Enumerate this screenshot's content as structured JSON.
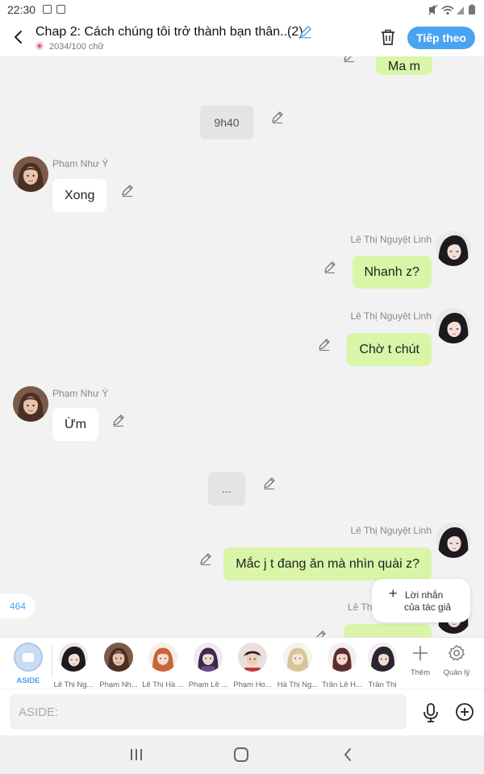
{
  "status_bar": {
    "time": "22:30"
  },
  "header": {
    "title": "Chap 2: Cách chúng tôi trở thành bạn thân..(2)",
    "word_count": "2034/100 chữ",
    "next_label": "Tiếp theo"
  },
  "messages": {
    "m0": {
      "text": "Ma m"
    },
    "m1": {
      "text": "9h40"
    },
    "m2": {
      "sender": "Phạm Như Ý",
      "text": "Xong"
    },
    "m3": {
      "sender": "Lê Thị Nguyệt Linh",
      "text": "Nhanh z?"
    },
    "m4": {
      "sender": "Lê Thị Nguyệt Linh",
      "text": "Chờ t chút"
    },
    "m5": {
      "sender": "Phạm Như Ý",
      "text": "Ừm"
    },
    "m6": {
      "text": "..."
    },
    "m7": {
      "sender": "Lê Thị Nguyệt Linh",
      "text": "Mắc j t đang ăn mà nhìn quài z?"
    },
    "m8": {
      "sender": "Lê Th"
    }
  },
  "count_badge": "464",
  "author_note": {
    "line1": "Lời nhắn",
    "line2": "của tác giả"
  },
  "characters": [
    {
      "label": "ASIDE"
    },
    {
      "label": "Lê Thị Ng..."
    },
    {
      "label": "Phạm Nh..."
    },
    {
      "label": "Lê Thị Hà ..."
    },
    {
      "label": "Phạm Lê ..."
    },
    {
      "label": "Phạm Ho..."
    },
    {
      "label": "Hà Thị Ng..."
    },
    {
      "label": "Trần Lê H..."
    },
    {
      "label": "Trần Thị"
    }
  ],
  "tools": {
    "add_label": "Thêm",
    "manage_label": "Quản lý"
  },
  "input": {
    "placeholder": "ASIDE:"
  },
  "colors": {
    "accent": "#4aa3f0",
    "right_bubble": "#d9f5a8",
    "left_bubble": "#ffffff",
    "background": "#f2f2f2"
  },
  "icons": [
    "back-arrow-icon",
    "pencil-icon",
    "trash-icon",
    "microphone-icon",
    "plus-circle-icon",
    "plus-icon",
    "gear-icon",
    "recents-icon",
    "home-icon",
    "nav-back-icon"
  ]
}
